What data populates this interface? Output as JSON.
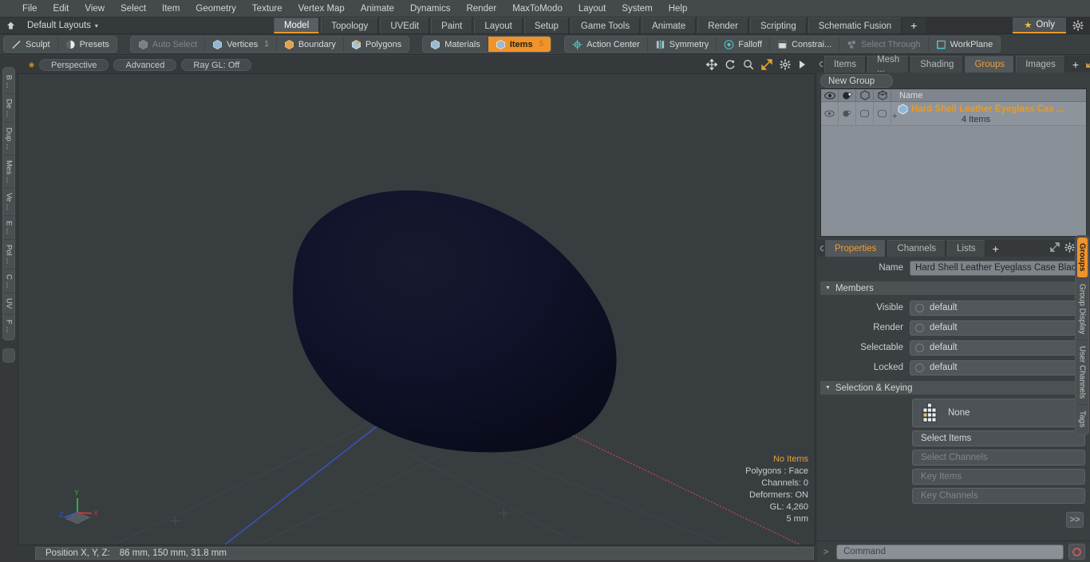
{
  "menubar": {
    "items": [
      "File",
      "Edit",
      "View",
      "Select",
      "Item",
      "Geometry",
      "Texture",
      "Vertex Map",
      "Animate",
      "Dynamics",
      "Render",
      "MaxToModo",
      "Layout",
      "System",
      "Help"
    ]
  },
  "layoutbar": {
    "home_icon": "home-icon",
    "layout_name": "Default Layouts",
    "caret": "▾",
    "tabs": [
      {
        "label": "Model",
        "active": true
      },
      {
        "label": "Topology",
        "active": false
      },
      {
        "label": "UVEdit",
        "active": false
      },
      {
        "label": "Paint",
        "active": false
      },
      {
        "label": "Layout",
        "active": false
      },
      {
        "label": "Setup",
        "active": false
      },
      {
        "label": "Game Tools",
        "active": false
      },
      {
        "label": "Animate",
        "active": false
      },
      {
        "label": "Render",
        "active": false
      },
      {
        "label": "Scripting",
        "active": false
      },
      {
        "label": "Schematic Fusion",
        "active": false
      }
    ],
    "add_label": "+",
    "only_label": "Only",
    "star": "★",
    "gear": "gear-icon"
  },
  "modebar": {
    "left_group": [
      {
        "label": "Sculpt",
        "icon": "pen-icon",
        "state": "normal"
      },
      {
        "label": "Presets",
        "icon": "sphere-icon",
        "state": "normal"
      }
    ],
    "select_group": [
      {
        "label": "Auto Select",
        "icon": "cube-icon",
        "state": "disabled",
        "badge": ""
      },
      {
        "label": "Vertices",
        "icon": "cube-icon",
        "state": "normal",
        "badge": "1"
      },
      {
        "label": "Boundary",
        "icon": "cube-icon",
        "state": "normal",
        "badge": ""
      },
      {
        "label": "Polygons",
        "icon": "cube-icon",
        "state": "normal",
        "badge": ""
      }
    ],
    "items_group": [
      {
        "label": "Materials",
        "icon": "cube-icon",
        "state": "normal",
        "badge": ""
      },
      {
        "label": "Items",
        "icon": "cube-icon",
        "state": "active",
        "badge": "5"
      }
    ],
    "action_group": [
      {
        "label": "Action Center",
        "icon": "target-icon",
        "state": "normal"
      },
      {
        "label": "Symmetry",
        "icon": "mirror-icon",
        "state": "normal"
      },
      {
        "label": "Falloff",
        "icon": "circle-icon",
        "state": "normal"
      },
      {
        "label": "Constrai...",
        "icon": "square-icon",
        "state": "normal"
      },
      {
        "label": "Select Through",
        "icon": "through-icon",
        "state": "disabled"
      },
      {
        "label": "WorkPlane",
        "icon": "plane-icon",
        "state": "normal"
      }
    ]
  },
  "left_strip": {
    "tabs": [
      "B ...",
      "De ...",
      "Dup ...",
      "Mes ...",
      "Ve ...",
      "E ...",
      "Pol ...",
      "C ...",
      "UV",
      "F ..."
    ]
  },
  "viewport": {
    "header": {
      "dot": "viewport-indicator",
      "buttons": [
        "Perspective",
        "Advanced",
        "Ray GL: Off"
      ],
      "icons": [
        "pan-icon",
        "rotate-icon",
        "zoom-icon",
        "fit-icon",
        "gear-icon",
        "play-icon"
      ]
    },
    "stats": [
      {
        "text": "No Items",
        "highlight": true
      },
      {
        "text": "Polygons : Face",
        "highlight": false
      },
      {
        "text": "Channels: 0",
        "highlight": false
      },
      {
        "text": "Deformers: ON",
        "highlight": false
      },
      {
        "text": "GL: 4,260",
        "highlight": false
      },
      {
        "text": "5 mm",
        "highlight": false
      }
    ],
    "gizmo": {
      "x": "X",
      "y": "Y",
      "z": "Z"
    },
    "model_color": "#0c0e1c",
    "background_color": "#383d40"
  },
  "statusbar": {
    "position_label": "Position X, Y, Z:",
    "position_value": "86 mm, 150 mm, 31.8 mm"
  },
  "rightpanel": {
    "tabs": [
      {
        "label": "Items",
        "active": false
      },
      {
        "label": "Mesh ...",
        "active": false
      },
      {
        "label": "Shading",
        "active": false
      },
      {
        "label": "Groups",
        "active": true
      },
      {
        "label": "Images",
        "active": false
      }
    ],
    "add_label": "+",
    "tail_icons": [
      "expand-icon",
      "chevron-right-icon"
    ],
    "new_group_label": "New Group",
    "list": {
      "columns": [
        "eye-icon",
        "render-icon",
        "cube-outline-icon",
        "cube-wire-icon"
      ],
      "name_header": "Name",
      "rows": [
        {
          "expander": "+",
          "icon": "group-cube-icon",
          "name": "Hard Shell Leather Eyeglass Cas ...",
          "sub": "4 Items"
        }
      ]
    }
  },
  "properties": {
    "tabs": [
      {
        "label": "Properties",
        "active": true
      },
      {
        "label": "Channels",
        "active": false
      },
      {
        "label": "Lists",
        "active": false
      }
    ],
    "add_label": "+",
    "tail_icons": [
      "expand-icon",
      "gear-icon",
      "chevron-right-icon"
    ],
    "name_label": "Name",
    "name_value": "Hard Shell Leather Eyeglass Case Blac",
    "members_section": "Members",
    "members_fields": [
      {
        "label": "Visible",
        "value": "default"
      },
      {
        "label": "Render",
        "value": "default"
      },
      {
        "label": "Selectable",
        "value": "default"
      },
      {
        "label": "Locked",
        "value": "default"
      }
    ],
    "selection_section": "Selection & Keying",
    "selection_mode": "None",
    "buttons": [
      {
        "label": "Select Items",
        "disabled": false
      },
      {
        "label": "Select Channels",
        "disabled": true
      },
      {
        "label": "Key Items",
        "disabled": true
      },
      {
        "label": "Key Channels",
        "disabled": true
      }
    ],
    "more_label": ">>"
  },
  "right_strip": {
    "tabs": [
      {
        "label": "Groups",
        "active": true
      },
      {
        "label": "Group Display",
        "active": false
      },
      {
        "label": "User Channels",
        "active": false
      },
      {
        "label": "Tags",
        "active": false
      }
    ]
  },
  "commandbar": {
    "prompt": ">",
    "placeholder": "Command",
    "record_icon": "record-icon"
  },
  "colors": {
    "accent": "#f0942a",
    "accent_text": "#e79b28",
    "panel_bg": "#3a3f42",
    "list_bg": "#8a9097"
  }
}
